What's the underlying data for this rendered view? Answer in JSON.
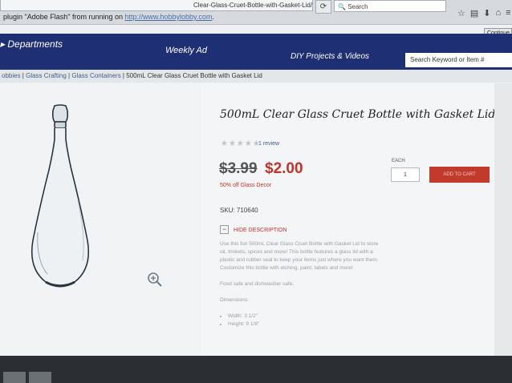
{
  "browser": {
    "url_text": "Clear-Glass-Cruet-Bottle-with-Gasket-Lid/p/",
    "search_label": "Search",
    "plugin_prefix": "plugin \"Adobe Flash\" from running on",
    "plugin_url": "http://www.hobbylobby.com",
    "plugin_suffix": ".",
    "continue_label": "Continue"
  },
  "nav": {
    "departments": "Departments",
    "weekly_ad": "Weekly Ad",
    "diy": "DIY Projects & Videos",
    "search_placeholder": "Search Keyword or Item #"
  },
  "breadcrumb": {
    "items": [
      "obbies",
      "Glass Crafting",
      "Glass Containers",
      "500mL Clear Glass Cruet Bottle with Gasket Lid"
    ]
  },
  "product": {
    "title": "500mL Clear Glass Cruet Bottle with Gasket Lid",
    "review_text": "1 review",
    "old_price": "$3.99",
    "new_price": "$2.00",
    "discount": "50% off Glass Decor",
    "each_label": "EACH",
    "quantity": "1",
    "add_to_cart": "ADD TO CART",
    "sku": "SKU: 710640",
    "hide_description": "HIDE DESCRIPTION",
    "description": "Use this fun 500mL Clear Glass Cruet Bottle with Gasket Lid to store oil, trinkets, spices and more! This bottle features a glass lid with a plastic and rubber seal to keep your items just where you want them. Customize this bottle with etching, paint, labels and more!",
    "care": "Food safe and dishwasher safe.",
    "dimensions_label": "Dimensions:",
    "dim_width": "Width: 3 1/2\"",
    "dim_height": "Height: 9 1/8\""
  }
}
